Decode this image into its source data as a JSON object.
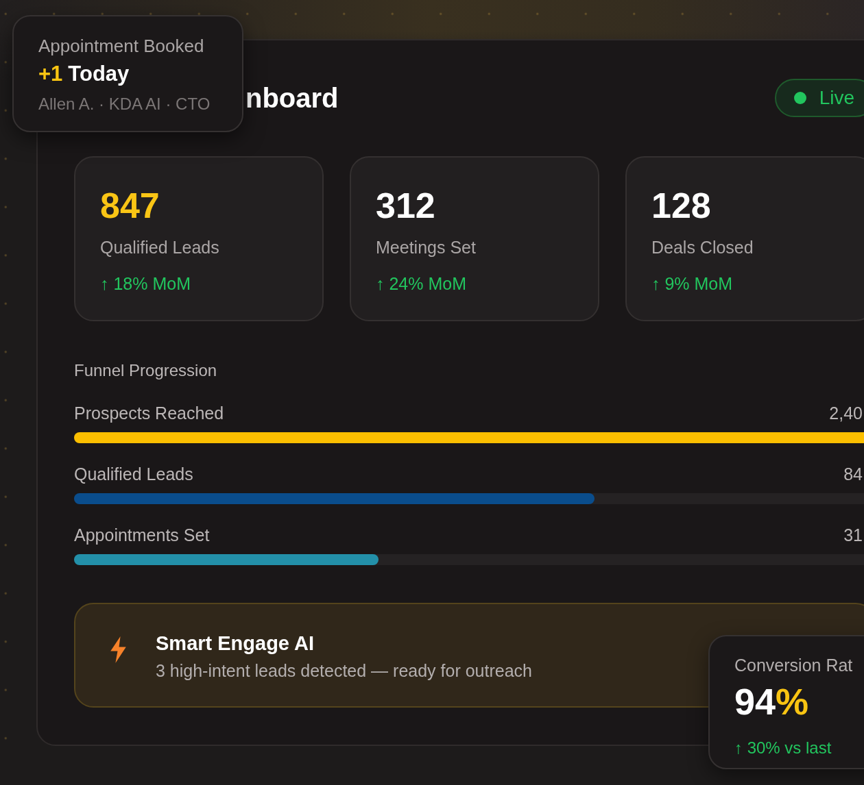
{
  "toast": {
    "title": "Appointment Booked",
    "delta": "+1",
    "label": "Today",
    "details": "Allen A. · KDA AI · CTO"
  },
  "dashboard": {
    "title": "nboard",
    "status": {
      "label": "Live"
    }
  },
  "stats": [
    {
      "value": "847",
      "color": "#fac515",
      "label": "Qualified Leads",
      "change": "↑ 18% MoM"
    },
    {
      "value": "312",
      "color": "#ffffff",
      "label": "Meetings Set",
      "change": "↑ 24% MoM"
    },
    {
      "value": "128",
      "color": "#ffffff",
      "label": "Deals Closed",
      "change": "↑ 9% MoM"
    }
  ],
  "funnel": {
    "title": "Funnel Progression",
    "stages": [
      {
        "label": "Prospects Reached",
        "value": "2,40",
        "level": 1,
        "color": "#fcbf00"
      },
      {
        "label": "Qualified Leads",
        "value": "84",
        "level": 0.65,
        "color": "#0a4d8c"
      },
      {
        "label": "Appointments Set",
        "value": "31",
        "level": 0.38,
        "color": "#2390a9"
      }
    ]
  },
  "alert": {
    "title": "Smart Engage AI",
    "message": "3 high-intent leads detected — ready for outreach"
  },
  "conversion": {
    "title": "Conversion Rat",
    "value": "94",
    "unit": "%",
    "change": "↑ 30% vs last"
  }
}
